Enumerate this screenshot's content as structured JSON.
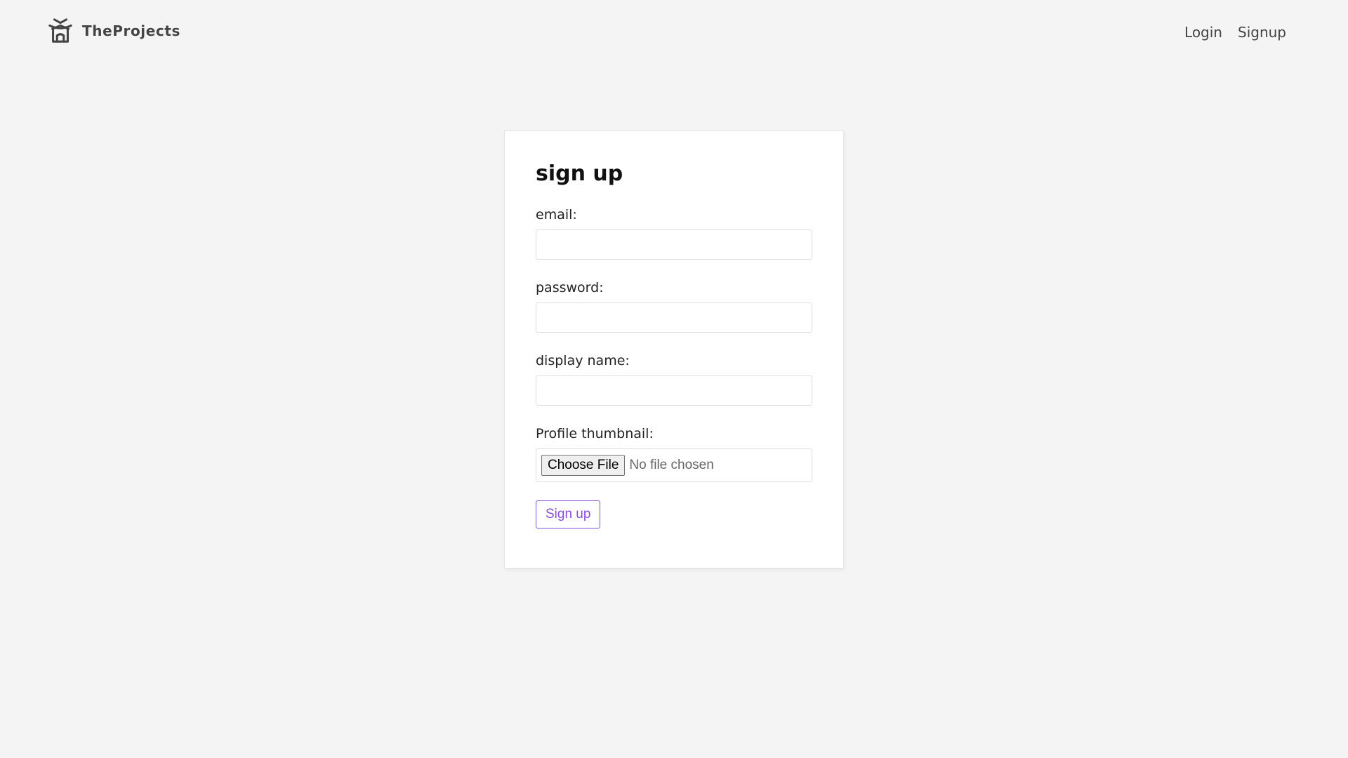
{
  "navbar": {
    "brand_name": "TheProjects",
    "brand_icon": "temple-icon",
    "links": [
      "Login",
      "Signup"
    ]
  },
  "form": {
    "title": "sign up",
    "email_label": "email:",
    "password_label": "password:",
    "display_name_label": "display name:",
    "thumbnail_label": "Profile thumbnail:",
    "choose_file_label": "Choose File",
    "file_status": "No file chosen",
    "submit_label": "Sign up",
    "email_value": "",
    "password_value": "",
    "display_name_value": ""
  },
  "colors": {
    "page_background": "#f4f4f4",
    "card_background": "#ffffff",
    "accent": "#8a4fd8",
    "text_dark": "#444444"
  }
}
